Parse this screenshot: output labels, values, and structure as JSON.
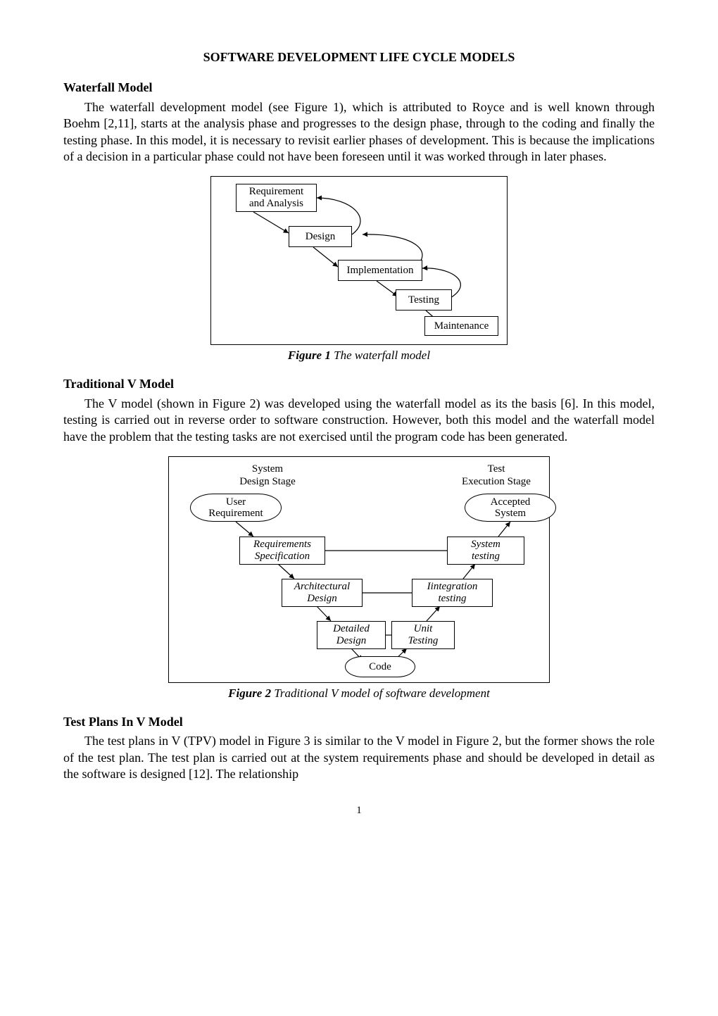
{
  "title": "SOFTWARE DEVELOPMENT LIFE CYCLE MODELS",
  "sections": [
    {
      "heading": " Waterfall Model",
      "para": "The waterfall development model (see Figure 1), which is attributed to Royce and is well known through Boehm [2,11], starts at the analysis phase and progresses to the design phase, through to the coding and finally the testing phase.  In this model, it is necessary to revisit earlier phases of development. This is because the implications of a decision in a particular phase could not have been foreseen until it was worked through in later phases."
    },
    {
      "heading": "Traditional V Model",
      "para": "The V model (shown in Figure 2) was developed using the waterfall model as its the basis [6]. In this model, testing is carried out in reverse order to software construction.  However, both this model and the waterfall model have the problem that the testing tasks are not exercised until the program code has been generated."
    },
    {
      "heading": "Test Plans In V Model",
      "para": "The test plans in V (TPV) model in Figure 3 is similar to the V model in Figure 2, but the former shows the role of the test plan.  The test plan is carried out at the system requirements phase and should be developed in detail as the software is designed [12]. The relationship"
    }
  ],
  "figure1": {
    "caption_label": "Figure 1",
    "caption_text": "  The waterfall model",
    "nodes": {
      "req": "Requirement\nand Analysis",
      "design": "Design",
      "impl": "Implementation",
      "test": "Testing",
      "maint": "Maintenance"
    }
  },
  "figure2": {
    "caption_label": "Figure 2",
    "caption_text": "  Traditional V model of software development",
    "stage_left": "System\nDesign Stage",
    "stage_right": "Test\nExecution Stage",
    "ovals": {
      "user": "User\nRequirement",
      "accepted": "Accepted\nSystem",
      "code": "Code"
    },
    "rects": {
      "reqspec": "Requirements\nSpecification",
      "arch": "Architectural\nDesign",
      "detailed": "Detailed\nDesign",
      "unit": "Unit\nTesting",
      "integ": "Iintegration\ntesting",
      "systest": "System\ntesting"
    }
  },
  "page_number": "1"
}
